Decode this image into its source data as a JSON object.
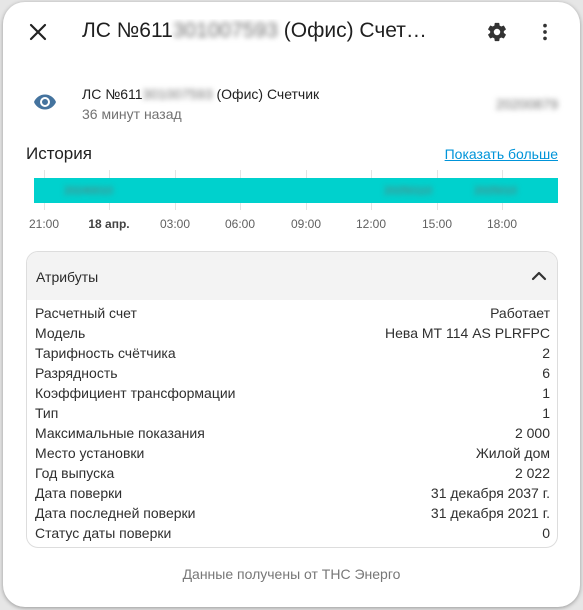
{
  "dialog": {
    "title_prefix": "ЛС №611",
    "title_blurred": "301007593",
    "title_suffix": "(Офис) Счет…"
  },
  "entity": {
    "name_prefix": "ЛС №611",
    "name_blurred": "301007593",
    "name_suffix": "(Офис) Счетчик",
    "last_changed": "36 минут назад",
    "state_blurred": "20200879"
  },
  "history": {
    "title": "История",
    "show_more": "Показать больше",
    "segments_blurred": [
      "20240010",
      "20250110",
      "2025010"
    ],
    "ticks": [
      "21:00",
      "18 апр.",
      "03:00",
      "06:00",
      "09:00",
      "12:00",
      "15:00",
      "18:00"
    ]
  },
  "attributes": {
    "title": "Атрибуты",
    "rows": [
      {
        "key": "Расчетный счет",
        "value": "Работает"
      },
      {
        "key": "Модель",
        "value": "Нева МТ 114 AS PLRFPC"
      },
      {
        "key": "Тарифность счётчика",
        "value": "2"
      },
      {
        "key": "Разрядность",
        "value": "6"
      },
      {
        "key": "Коэффициент трансформации",
        "value": "1"
      },
      {
        "key": "Тип",
        "value": "1"
      },
      {
        "key": "Максимальные показания",
        "value": "2 000"
      },
      {
        "key": "Место установки",
        "value": "Жилой дом"
      },
      {
        "key": "Год выпуска",
        "value": "2 022"
      },
      {
        "key": "Дата поверки",
        "value": "31 декабря 2037 г."
      },
      {
        "key": "Дата последней поверки",
        "value": "31 декабря 2021 г."
      },
      {
        "key": "Статус даты поверки",
        "value": "0"
      }
    ]
  },
  "footer": {
    "attribution": "Данные получены от ТНС Энерго"
  },
  "icons": {
    "close": "close-icon",
    "settings": "gear-icon",
    "more": "dots-vertical-icon",
    "entity": "eye-icon",
    "collapse": "chevron-up-icon"
  },
  "colors": {
    "accent": "#00d1cd",
    "link": "#0094d9",
    "eye": "#44739e"
  }
}
